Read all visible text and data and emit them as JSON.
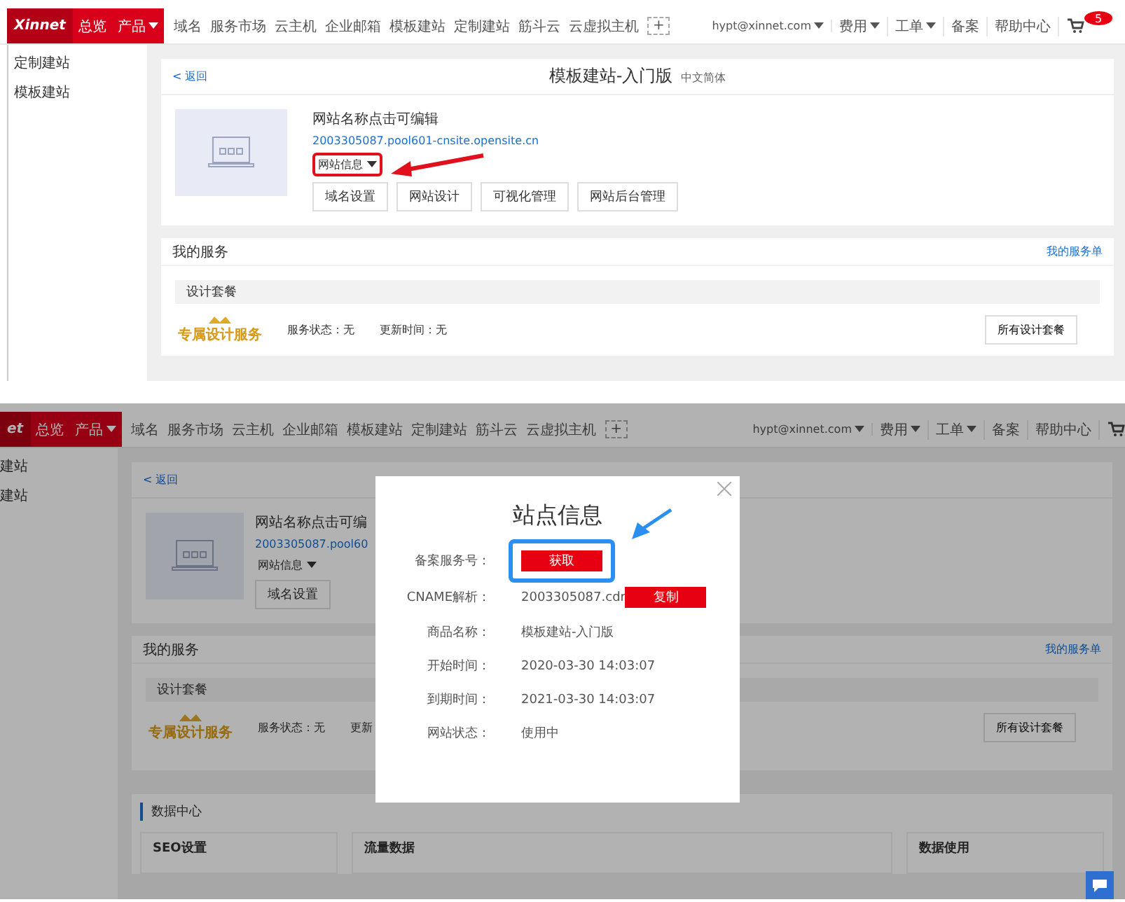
{
  "screens": [
    {
      "logo": "Xinnet",
      "primary_nav": [
        {
          "label": "总览",
          "dropdown": false
        },
        {
          "label": "产品",
          "dropdown": true
        }
      ],
      "nav_links": [
        "域名",
        "服务市场",
        "云主机",
        "企业邮箱",
        "模板建站",
        "定制建站",
        "筋斗云",
        "云虚拟主机"
      ],
      "add_label": "+",
      "user_menu": [
        {
          "label": "hypt@xinnet.com",
          "dropdown": true
        },
        {
          "label": "费用",
          "dropdown": true
        },
        {
          "label": "工单",
          "dropdown": true
        },
        {
          "label": "备案",
          "dropdown": false
        },
        {
          "label": "帮助中心",
          "dropdown": false
        }
      ],
      "cart_badge": "5",
      "sidebar": [
        "定制建站",
        "模板建站"
      ],
      "back": "< 返回",
      "product_title": "模板建站-入门版",
      "product_tag": "中文简体",
      "site_name": "网站名称点击可编辑",
      "site_url": "2003305087.pool601-cnsite.opensite.cn",
      "site_menu": {
        "label": "网站信息",
        "highlighted": true
      },
      "site_buttons": [
        "域名设置",
        "网站设计",
        "可视化管理",
        "网站后台管理"
      ],
      "services": {
        "title": "我的服务",
        "link": "我的服务单",
        "section": "设计套餐",
        "badge": "专属设计服务",
        "status": "服务状态：无",
        "update": "更新时间：无",
        "button": "所有设计套餐"
      }
    },
    {
      "dimmed": true,
      "logo": "et",
      "primary_nav": [
        {
          "label": "总览",
          "dropdown": false
        },
        {
          "label": "产品",
          "dropdown": true
        }
      ],
      "nav_links": [
        "域名",
        "服务市场",
        "云主机",
        "企业邮箱",
        "模板建站",
        "定制建站",
        "筋斗云",
        "云虚拟主机"
      ],
      "add_label": "+",
      "user_menu": [
        {
          "label": "hypt@xinnet.com",
          "dropdown": true
        },
        {
          "label": "费用",
          "dropdown": true
        },
        {
          "label": "工单",
          "dropdown": true
        },
        {
          "label": "备案",
          "dropdown": false
        },
        {
          "label": "帮助中心",
          "dropdown": false
        }
      ],
      "sidebar": [
        "建站",
        "建站"
      ],
      "back": "< 返回",
      "site_name": "网站名称点击可编",
      "site_url": "2003305087.pool60",
      "site_menu": {
        "label": "网站信息",
        "highlighted": false
      },
      "site_buttons": [
        "域名设置"
      ],
      "services": {
        "title": "我的服务",
        "link": "我的服务单",
        "section": "设计套餐",
        "badge": "专属设计服务",
        "status": "服务状态：无",
        "update": "更新",
        "button": "所有设计套餐"
      },
      "data_center": {
        "title": "数据中心",
        "cards": [
          "SEO设置",
          "流量数据",
          "数据使用"
        ]
      },
      "modal": {
        "title": "站点信息",
        "rows": [
          {
            "kind": "button",
            "label": "备案服务号：",
            "button": "获取",
            "highlighted": true
          },
          {
            "kind": "copy",
            "label": "CNAME解析：",
            "value": "2003305087.cdr",
            "button": "复制"
          },
          {
            "kind": "text",
            "label": "商品名称：",
            "value": "模板建站-入门版"
          },
          {
            "kind": "text",
            "label": "开始时间：",
            "value": "2020-03-30 14:03:07"
          },
          {
            "kind": "text",
            "label": "到期时间：",
            "value": "2021-03-30 14:03:07"
          },
          {
            "kind": "text",
            "label": "网站状态：",
            "value": "使用中"
          }
        ]
      }
    }
  ]
}
